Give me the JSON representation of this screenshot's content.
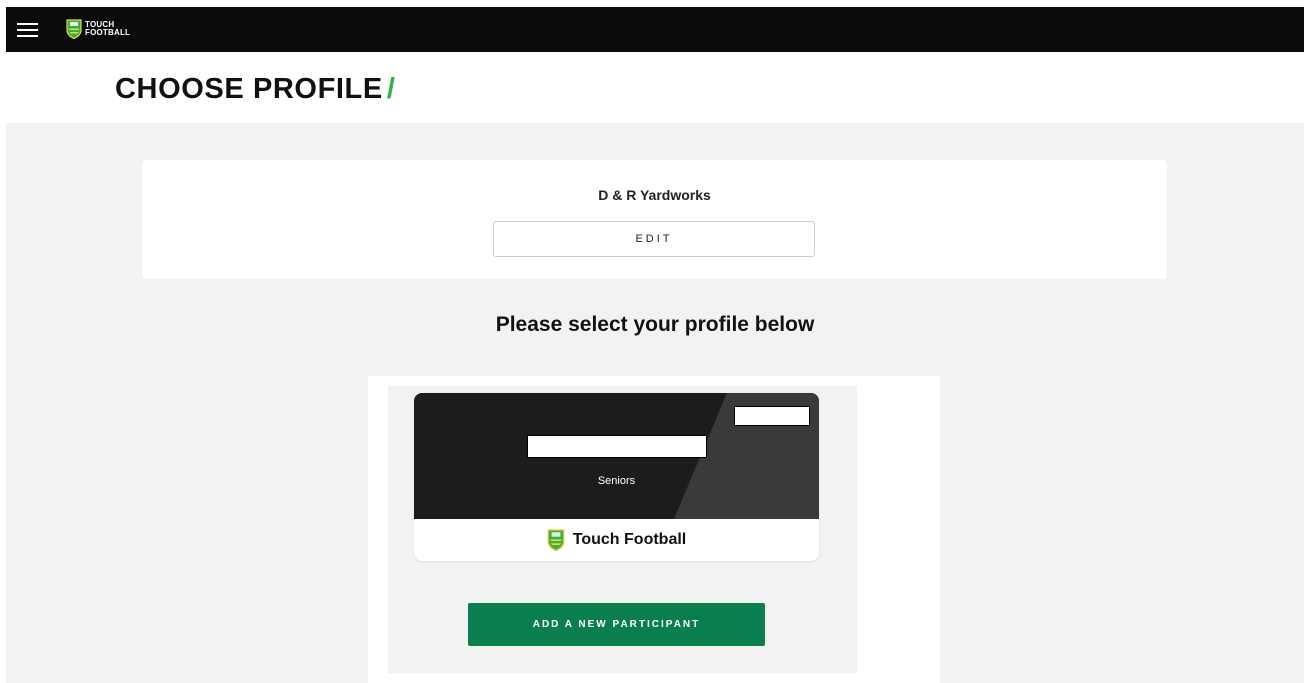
{
  "nav": {
    "menu_icon": "hamburger-menu-icon",
    "logo_icon": "touch-football-shield-icon",
    "logo_line1": "TOUCH",
    "logo_line2": "FOOTBALL"
  },
  "header": {
    "title": "CHOOSE PROFILE",
    "title_accent": "/"
  },
  "team": {
    "name": "D & R Yardworks",
    "edit_label": "EDIT"
  },
  "profiles": {
    "heading": "Please select your profile below",
    "items": [
      {
        "category": "Seniors",
        "sport": "Touch Football",
        "sport_icon": "touch-football-shield-icon"
      }
    ],
    "add_label": "ADD A NEW PARTICIPANT"
  },
  "colors": {
    "navbar": "#0b0b0b",
    "accent_green": "#2fb34a",
    "button_green": "#0b7e4f",
    "body_bg": "#f2f2f2",
    "card_dark": "#1c1c1c"
  }
}
